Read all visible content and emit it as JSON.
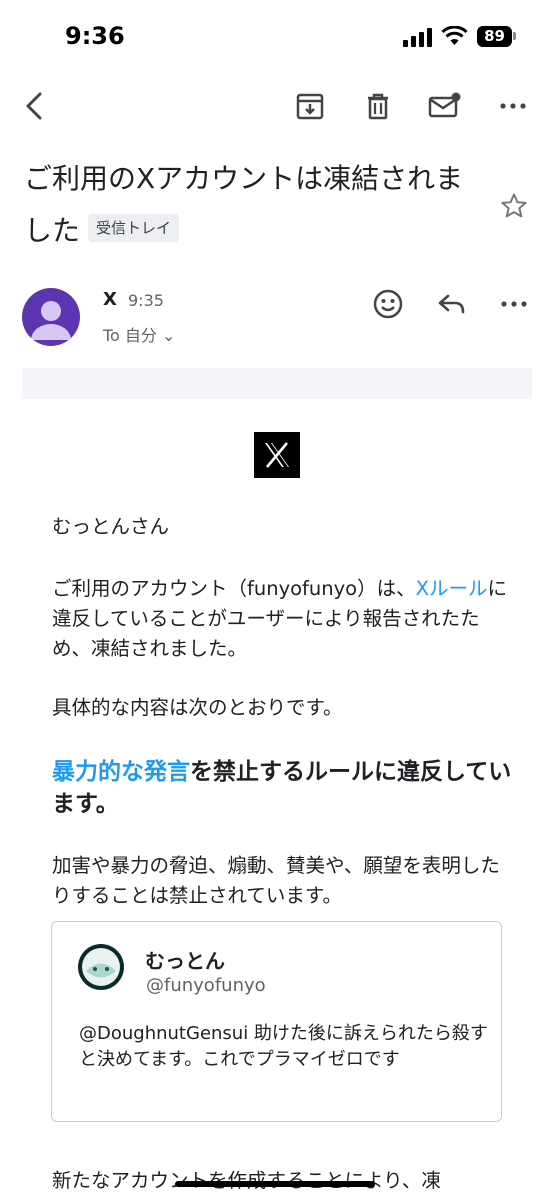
{
  "status_bar": {
    "time": "9:36",
    "battery": "89"
  },
  "email": {
    "subject": "ご利用のXアカウントは凍結されました",
    "label": "受信トレイ",
    "sender": "X",
    "time": "9:35",
    "to": "To 自分 ⌄"
  },
  "body": {
    "greeting": "むっとんさん",
    "para1_prefix": "ご利用のアカウント（funyofunyo）は、",
    "para1_link": "Xルール",
    "para1_suffix": "に違反していることがユーザーにより報告されたため、凍結されました。",
    "para2": "具体的な内容は次のとおりです。",
    "headline_link": "暴力的な発言",
    "headline_suffix": "を禁止するルールに違反しています。",
    "para3": "加害や暴力の脅迫、煽動、賛美や、願望を表明したりすることは禁止されています。",
    "para4": "新たなアカウントを作成することにより、凍"
  },
  "tweet": {
    "name": "むっとん",
    "handle": "@funyofunyo",
    "text": "@DoughnutGensui 助けた後に訴えられたら殺すと決めてます。これでプラマイゼロです"
  },
  "colors": {
    "link": "#1d9bf0",
    "avatar": "#5e35b1",
    "chip_bg": "#eceef1"
  }
}
